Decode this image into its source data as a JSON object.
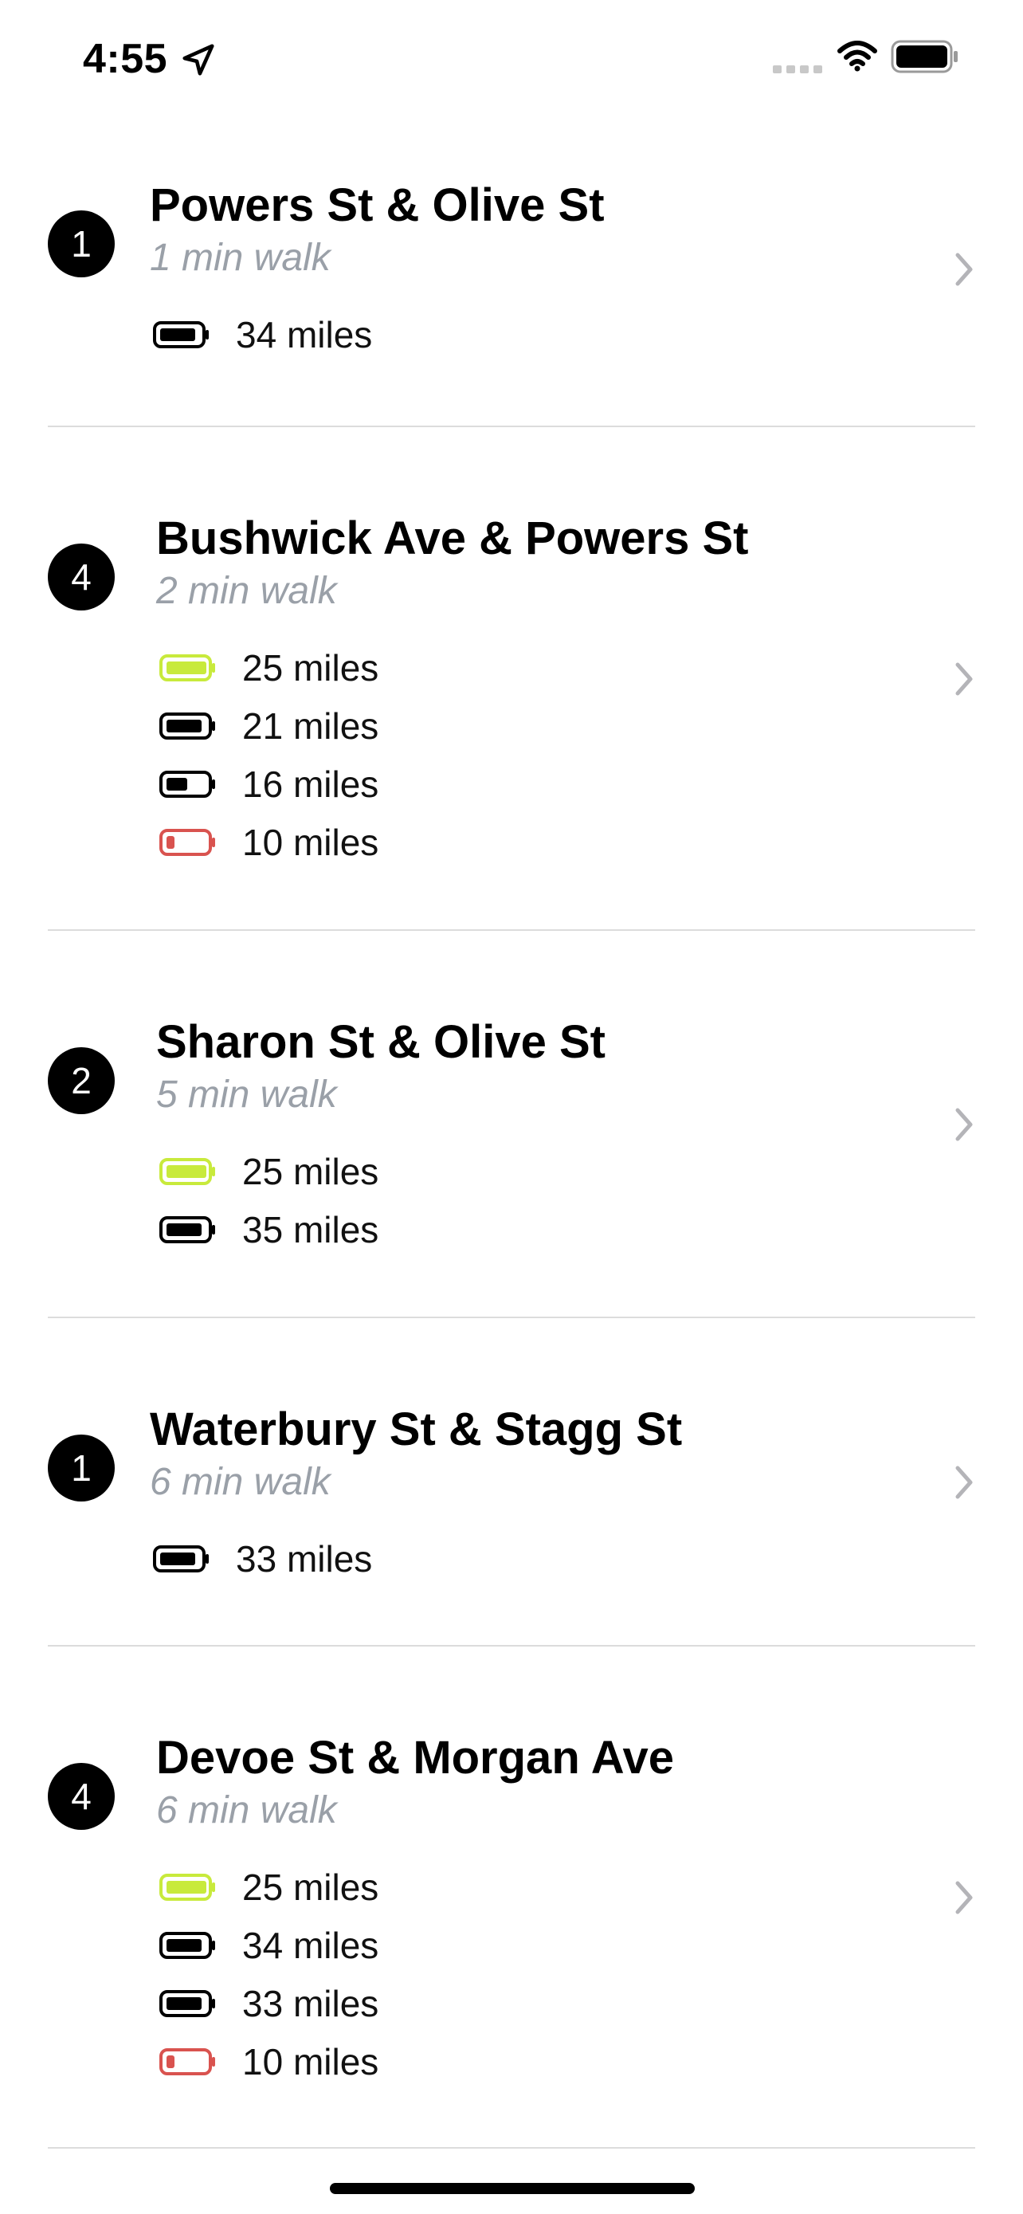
{
  "status": {
    "time": "4:55"
  },
  "stations": [
    {
      "count": "1",
      "name": "Powers St & Olive St",
      "walk": "1 min walk",
      "bikes": [
        {
          "miles": "34 miles",
          "charge": "full"
        }
      ]
    },
    {
      "count": "4",
      "name": "Bushwick Ave & Powers St",
      "walk": "2 min walk",
      "bikes": [
        {
          "miles": "25 miles",
          "charge": "full-green"
        },
        {
          "miles": "21 miles",
          "charge": "full"
        },
        {
          "miles": "16 miles",
          "charge": "medium"
        },
        {
          "miles": "10 miles",
          "charge": "low"
        }
      ]
    },
    {
      "count": "2",
      "name": "Sharon St & Olive St",
      "walk": "5 min walk",
      "bikes": [
        {
          "miles": "25 miles",
          "charge": "full-green"
        },
        {
          "miles": "35 miles",
          "charge": "full"
        }
      ]
    },
    {
      "count": "1",
      "name": "Waterbury St & Stagg St",
      "walk": "6 min walk",
      "bikes": [
        {
          "miles": "33 miles",
          "charge": "full"
        }
      ]
    },
    {
      "count": "4",
      "name": "Devoe St & Morgan Ave",
      "walk": "6 min walk",
      "bikes": [
        {
          "miles": "25 miles",
          "charge": "full-green"
        },
        {
          "miles": "34 miles",
          "charge": "full"
        },
        {
          "miles": "33 miles",
          "charge": "full"
        },
        {
          "miles": "10 miles",
          "charge": "low"
        }
      ]
    }
  ],
  "icons": {
    "location": "location-arrow-icon",
    "signal": "cellular-signal-icon",
    "wifi": "wifi-icon",
    "battery": "battery-icon",
    "bike_battery": "bike-battery-icon",
    "chevron": "chevron-right-icon"
  },
  "colors": {
    "badge": "#000000",
    "walk_text": "#9aa0a8",
    "divider": "#dcdcdc",
    "battery_green": "#c8ea3c",
    "battery_low": "#d9534f",
    "chevron": "#b4b4b8"
  }
}
